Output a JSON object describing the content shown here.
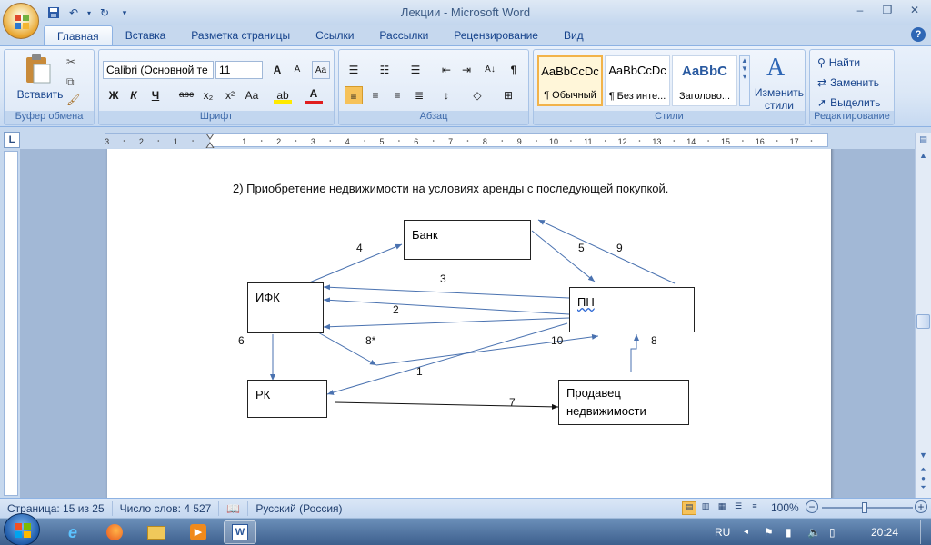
{
  "window": {
    "title": "Лекции - Microsoft Word"
  },
  "ribbon": {
    "tabs": [
      "Главная",
      "Вставка",
      "Разметка страницы",
      "Ссылки",
      "Рассылки",
      "Рецензирование",
      "Вид"
    ],
    "active_tab": "Главная",
    "clipboard": {
      "paste_label": "Вставить",
      "group": "Буфер обмена"
    },
    "font": {
      "name": "Calibri (Основной те",
      "size": "11",
      "group": "Шрифт"
    },
    "paragraph": {
      "group": "Абзац"
    },
    "styles": {
      "group": "Стили",
      "items": [
        {
          "sample": "AaBbCcDc",
          "name": "¶ Обычный"
        },
        {
          "sample": "AaBbCcDc",
          "name": "¶ Без инте..."
        },
        {
          "sample": "AaBbC",
          "name": "Заголово..."
        }
      ],
      "change_label_1": "Изменить",
      "change_label_2": "стили"
    },
    "editing": {
      "find": "Найти",
      "replace": "Заменить",
      "select": "Выделить",
      "group": "Редактирование"
    }
  },
  "ruler": {
    "left_marks": [
      "3",
      "2",
      "1"
    ],
    "marks": [
      "1",
      "2",
      "3",
      "4",
      "5",
      "6",
      "7",
      "8",
      "9",
      "10",
      "11",
      "12",
      "13",
      "14",
      "15",
      "16",
      "17"
    ],
    "corner": "L"
  },
  "document": {
    "heading": "2)    Приобретение недвижимости на условиях аренды с последующей покупкой.",
    "nodes": {
      "bank": "Банк",
      "ifk": "ИФК",
      "pn": "ПН",
      "rk": "РК",
      "seller_line1": "Продавец",
      "seller_line2": "недвижимости"
    },
    "edge_labels": {
      "e1": "1",
      "e2": "2",
      "e3": "3",
      "e4": "4",
      "e5": "5",
      "e6": "6",
      "e7": "7",
      "e8": "8",
      "e8s": "8*",
      "e9": "9",
      "e10": "10"
    }
  },
  "status": {
    "page": "Страница: 15 из 25",
    "words": "Число слов: 4 527",
    "language": "Русский (Россия)",
    "zoom": "100%"
  },
  "taskbar": {
    "lang": "RU",
    "time": "20:24"
  }
}
